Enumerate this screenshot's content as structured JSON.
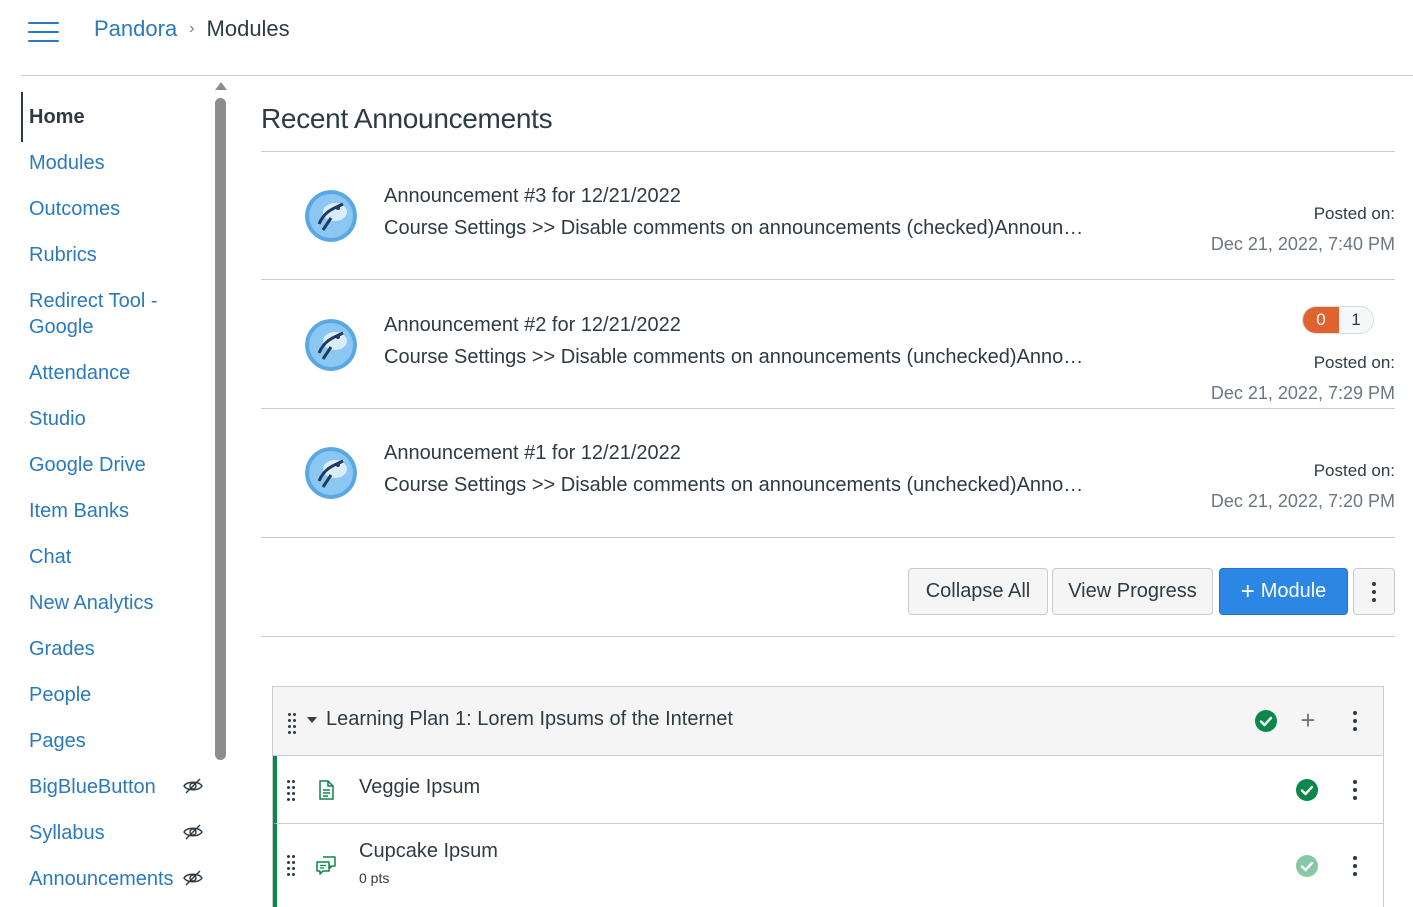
{
  "header": {
    "breadcrumb": {
      "course": "Pandora",
      "separator": "›",
      "current": "Modules"
    }
  },
  "sidebar": {
    "items": [
      {
        "label": "Home",
        "active": true,
        "hidden": false
      },
      {
        "label": "Modules",
        "active": false,
        "hidden": false
      },
      {
        "label": "Outcomes",
        "active": false,
        "hidden": false
      },
      {
        "label": "Rubrics",
        "active": false,
        "hidden": false
      },
      {
        "label": "Redirect Tool - Google",
        "active": false,
        "hidden": false
      },
      {
        "label": "Attendance",
        "active": false,
        "hidden": false
      },
      {
        "label": "Studio",
        "active": false,
        "hidden": false
      },
      {
        "label": "Google Drive",
        "active": false,
        "hidden": false
      },
      {
        "label": "Item Banks",
        "active": false,
        "hidden": false
      },
      {
        "label": "Chat",
        "active": false,
        "hidden": false
      },
      {
        "label": "New Analytics",
        "active": false,
        "hidden": false
      },
      {
        "label": "Grades",
        "active": false,
        "hidden": false
      },
      {
        "label": "People",
        "active": false,
        "hidden": false
      },
      {
        "label": "Pages",
        "active": false,
        "hidden": false
      },
      {
        "label": "BigBlueButton",
        "active": false,
        "hidden": true
      },
      {
        "label": "Syllabus",
        "active": false,
        "hidden": true
      },
      {
        "label": "Announcements",
        "active": false,
        "hidden": true
      }
    ]
  },
  "announcements": {
    "title": "Recent Announcements",
    "posted_label": "Posted on:",
    "items": [
      {
        "title": "Announcement #3 for 12/21/2022",
        "excerpt": "Course Settings >> Disable comments on announcements (checked)Announce...",
        "date": "Dec 21, 2022, 7:40 PM",
        "unread": null,
        "total": null
      },
      {
        "title": "Announcement #2 for 12/21/2022",
        "excerpt": "Course Settings >> Disable comments on announcements (unchecked)Annou...",
        "date": "Dec 21, 2022, 7:29 PM",
        "unread": "0",
        "total": "1"
      },
      {
        "title": "Announcement #1 for 12/21/2022",
        "excerpt": "Course Settings >> Disable comments on announcements (unchecked)Annou...",
        "date": "Dec 21, 2022, 7:20 PM",
        "unread": null,
        "total": null
      }
    ]
  },
  "toolbar": {
    "collapse_all": "Collapse All",
    "view_progress": "View Progress",
    "add_module": "Module",
    "add_module_icon": "plus-icon",
    "more_icon": "kebab-icon"
  },
  "module": {
    "title": "Learning Plan 1: Lorem Ipsums of the Internet",
    "published": true,
    "items": [
      {
        "title": "Veggie Ipsum",
        "type": "page",
        "icon": "page-icon",
        "meta": "",
        "published": true
      },
      {
        "title": "Cupcake Ipsum",
        "type": "discussion",
        "icon": "discussion-icon",
        "meta": "0 pts",
        "published": true
      }
    ]
  },
  "colors": {
    "link": "#2b7abc",
    "primary_button": "#2b87e3",
    "published_green": "#0b874b",
    "unread_badge": "#e0622f",
    "text": "#2d3b45"
  }
}
